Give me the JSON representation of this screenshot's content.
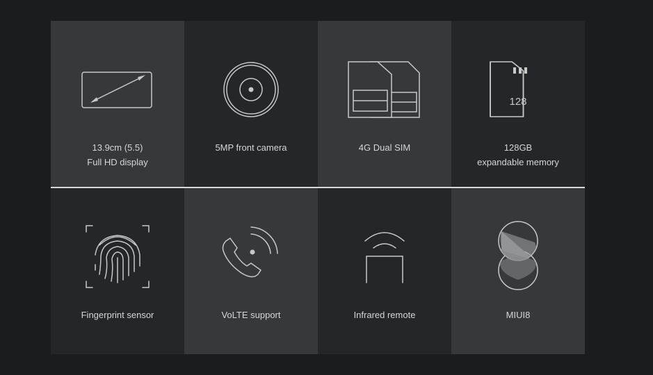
{
  "features": [
    {
      "id": "display",
      "icon": "display-diagonal-icon",
      "lines": [
        "13.9cm (5.5)",
        "Full HD display"
      ]
    },
    {
      "id": "camera",
      "icon": "camera-lens-icon",
      "lines": [
        "5MP front camera"
      ]
    },
    {
      "id": "dual-sim",
      "icon": "dual-sim-icon",
      "lines": [
        "4G Dual SIM"
      ]
    },
    {
      "id": "memory",
      "icon": "sd-card-icon",
      "icon_text": "128",
      "lines": [
        "128GB",
        "expandable memory"
      ]
    },
    {
      "id": "fingerprint",
      "icon": "fingerprint-icon",
      "lines": [
        "Fingerprint sensor"
      ]
    },
    {
      "id": "volte",
      "icon": "phone-signal-icon",
      "lines": [
        "VoLTE support"
      ]
    },
    {
      "id": "infrared",
      "icon": "infrared-icon",
      "lines": [
        "Infrared remote"
      ]
    },
    {
      "id": "miui",
      "icon": "miui-logo-icon",
      "lines": [
        "MIUI8"
      ]
    }
  ],
  "colors": {
    "background": "#1b1c1e",
    "cell_light": "#36383c",
    "cell_dark": "#25262a",
    "stroke": "#c8c8c8",
    "text": "#d6d6d6",
    "divider": "#d8d8d8"
  }
}
